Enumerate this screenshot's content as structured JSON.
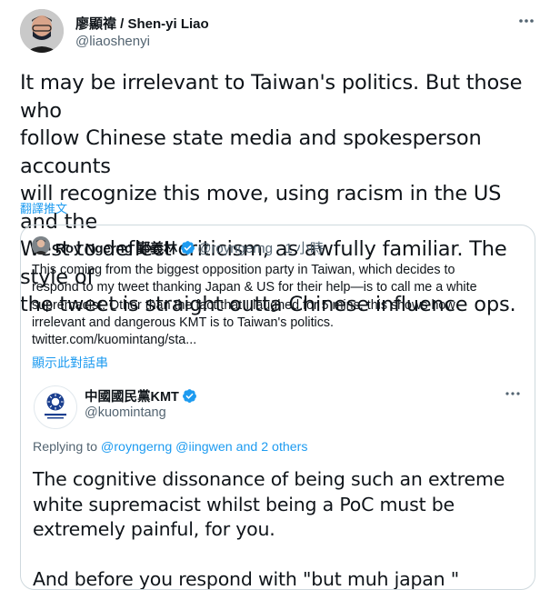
{
  "tweet": {
    "author_name": "廖顯禕 / Shen-yi Liao",
    "author_handle": "@liaoshenyi",
    "more_icon": "more-horizontal-icon",
    "text_lines": [
      "It may be irrelevant to Taiwan's politics. But those who",
      "follow Chinese state media and spokesperson accounts",
      "will recognize this move, using racism in the US and the",
      "West to deflect criticism, as awfully familiar. The style of",
      "the tweet is straight outta Chinese influence ops."
    ],
    "translate_label": "翻譯推文"
  },
  "quote": {
    "author_name": "Roy Ngerng 鄞義林",
    "author_handle": "@royngerng",
    "separator": "·",
    "time": "1 小時",
    "text_lines": [
      "This coming from the biggest opposition party in Taiwan, which decides to",
      "respond to my tweet thanking Japan & US for their help—is to call me a white",
      "supremacist. Other than the fact that I laughed for 5 mins, this shows how",
      "irrelevant and dangerous KMT is to Taiwan's politics.",
      "twitter.com/kuomintang/sta..."
    ],
    "show_thread_label": "顯示此對話串",
    "verified_color": "#1d9bf0"
  },
  "embedded": {
    "author_name": "中國國民黨KMT",
    "author_handle": "@kuomintang",
    "replying_prefix": "Replying to ",
    "replying_links": "@royngerng @iingwen and 2 others",
    "text_lines": [
      "The cognitive dissonance of being such an extreme",
      "white supremacist whilst being a PoC must be",
      "extremely painful, for you.",
      "",
      "And before you respond with \"but muh japan \" please"
    ]
  },
  "colors": {
    "link": "#1d9bf0",
    "secondary": "#536471",
    "text": "#0f1419",
    "border": "#cfd9de"
  }
}
